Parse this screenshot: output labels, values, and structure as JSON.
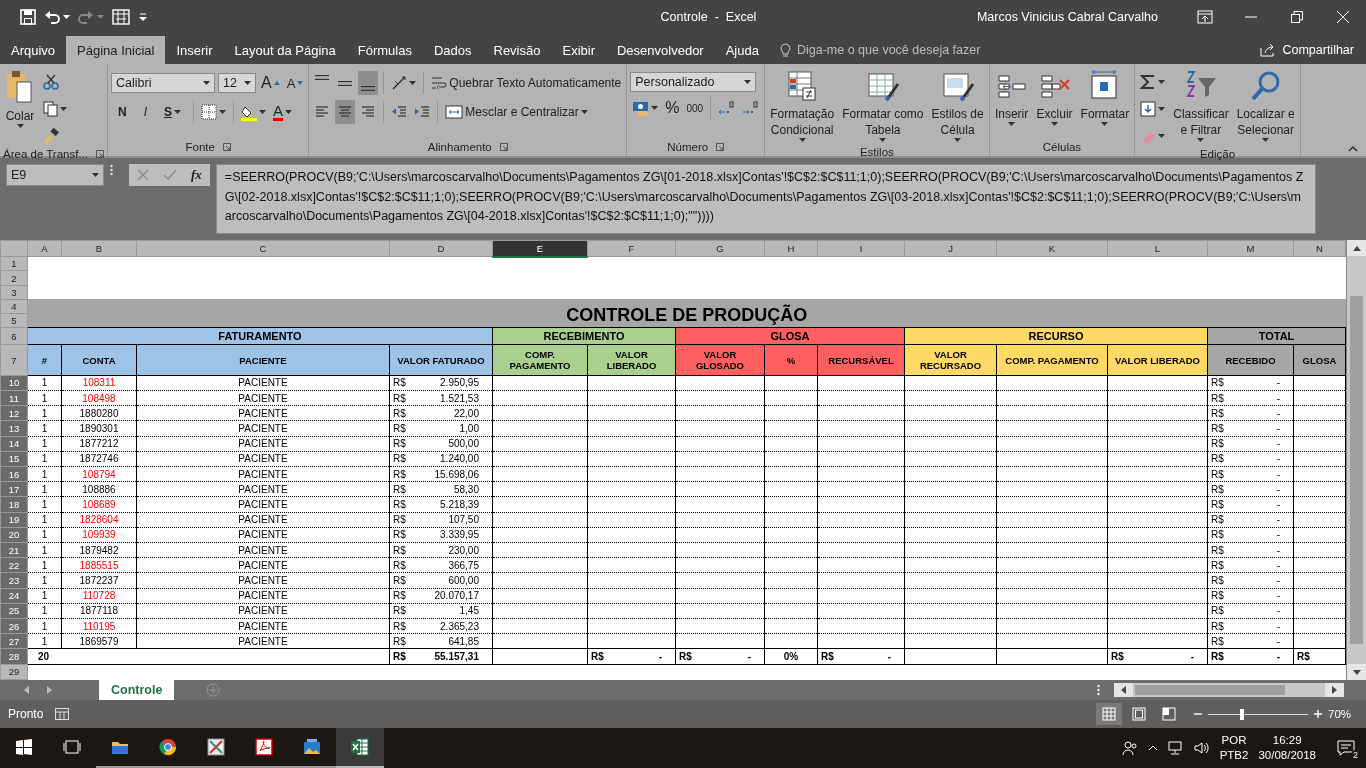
{
  "window": {
    "title": "Controle  -  Excel",
    "user": "Marcos Vinicius Cabral Carvalho"
  },
  "tabs": [
    {
      "label": "Arquivo",
      "selected": false
    },
    {
      "label": "Página Inicial",
      "selected": true
    },
    {
      "label": "Inserir",
      "selected": false
    },
    {
      "label": "Layout da Página",
      "selected": false
    },
    {
      "label": "Fórmulas",
      "selected": false
    },
    {
      "label": "Dados",
      "selected": false
    },
    {
      "label": "Revisão",
      "selected": false
    },
    {
      "label": "Exibir",
      "selected": false
    },
    {
      "label": "Desenvolvedor",
      "selected": false
    },
    {
      "label": "Ajuda",
      "selected": false
    }
  ],
  "tell_me": {
    "placeholder": "Diga-me o que você deseja fazer"
  },
  "share": "Compartilhar",
  "ribbon": [
    {
      "kind": "clipboard",
      "label": "Área de Transf...",
      "paste": "Colar"
    },
    {
      "kind": "font",
      "label": "Fonte",
      "font": "Calibri",
      "size": "12",
      "grow": "A",
      "shrink": "A",
      "bold": "N",
      "italic": "I",
      "underline": "S",
      "font_color": "A"
    },
    {
      "kind": "alignment",
      "label": "Alinhamento",
      "wrap": "Quebrar Texto Automaticamente",
      "merge": "Mesclar e Centralizar",
      "vertical": [
        {
          "selected": false
        },
        {
          "selected": false
        },
        {
          "selected": true
        }
      ],
      "horizontal": [
        {
          "selected": false
        },
        {
          "selected": true
        },
        {
          "selected": false
        }
      ]
    },
    {
      "kind": "number",
      "label": "Número",
      "format": "Personalizado",
      "percent": "%",
      "thousands": "000"
    },
    {
      "kind": "styles",
      "label": "Estilos",
      "buttons": [
        {
          "lines": [
            "Formatação",
            "Condicional"
          ]
        },
        {
          "lines": [
            "Formatar como",
            "Tabela"
          ]
        },
        {
          "lines": [
            "Estilos de",
            "Célula"
          ]
        }
      ]
    },
    {
      "kind": "cells",
      "label": "Células",
      "buttons": [
        "Inserir",
        "Excluir",
        "Formatar"
      ]
    },
    {
      "kind": "editing",
      "label": "Edição",
      "buttons": [
        {
          "lines": [
            "Classificar",
            "e Filtrar"
          ]
        },
        {
          "lines": [
            "Localizar e",
            "Selecionar"
          ]
        }
      ]
    }
  ],
  "formula_bar": {
    "cell": "E9",
    "fx": "fx",
    "formula": "=SEERRO(PROCV(B9;'C:\\Users\\marcoscarvalho\\Documents\\Pagamentos ZG\\[01-2018.xlsx]Contas'!$C$2:$C$11;1;0);SEERRO(PROCV(B9;'C:\\Users\\marcoscarvalho\\Documents\\Pagamentos ZG\\[02-2018.xlsx]Contas'!$C$2:$C$11;1;0);SEERRO(PROCV(B9;'C:\\Users\\marcoscarvalho\\Documents\\Pagamentos ZG\\[03-2018.xlsx]Contas'!$C$2:$C$11;1;0);SEERRO(PROCV(B9;'C:\\Users\\marcoscarvalho\\Documents\\Pagamentos ZG\\[04-2018.xlsx]Contas'!$C$2:$C$11;1;0);\"\"))))"
  },
  "sheet": {
    "columns": [
      {
        "label": "A",
        "selected": false
      },
      {
        "label": "B",
        "selected": false
      },
      {
        "label": "C",
        "selected": false
      },
      {
        "label": "D",
        "selected": false
      },
      {
        "label": "E",
        "selected": true
      },
      {
        "label": "F",
        "selected": false
      },
      {
        "label": "G",
        "selected": false
      },
      {
        "label": "H",
        "selected": false
      },
      {
        "label": "I",
        "selected": false
      },
      {
        "label": "J",
        "selected": false
      },
      {
        "label": "K",
        "selected": false
      },
      {
        "label": "L",
        "selected": false
      },
      {
        "label": "M",
        "selected": false
      },
      {
        "label": "N",
        "selected": false
      }
    ],
    "blank_rows": [
      {
        "row": "1",
        "highlighted": false
      },
      {
        "row": "2",
        "highlighted": false
      },
      {
        "row": "3",
        "highlighted": false
      }
    ],
    "title": {
      "text": "CONTROLE DE PRODUÇÃO",
      "rows": [
        {
          "row": "4",
          "highlighted": false
        },
        {
          "row": "5",
          "highlighted": false
        }
      ]
    },
    "group_row": {
      "row": "6",
      "highlighted": false,
      "groups": [
        {
          "label": "FATURAMENTO",
          "color": "#9dc3e6",
          "columns": [
            "#",
            "CONTA",
            "PACIENTE",
            "VALOR FATURADO"
          ]
        },
        {
          "label": "RECEBIMENTO",
          "color": "#a9d08e",
          "columns": [
            "COMP. PAGAMENTO",
            "VALOR LIBERADO"
          ]
        },
        {
          "label": "GLOSA",
          "color": "#ff5f5f",
          "columns": [
            "VALOR GLOSADO",
            "%",
            "RECURSÁVEL"
          ]
        },
        {
          "label": "RECURSO",
          "color": "#ffd966",
          "columns": [
            "VALOR RECURSADO",
            "COMP. PAGAMENTO",
            "VALOR LIBERADO"
          ]
        },
        {
          "label": "TOTAL",
          "color": "#a6a6a6",
          "columns": [
            "RECEBIDO",
            "GLOSA"
          ]
        }
      ]
    },
    "header_row": {
      "row": "7",
      "highlighted": false
    },
    "rows": [
      {
        "row": "10",
        "highlighted": true,
        "count": "1",
        "account": "108311",
        "flagged": true,
        "patient": "PACIENTE",
        "billed": {
          "currency": "R$",
          "value": "2.950,95"
        },
        "received": {
          "currency": "R$",
          "value": "-"
        }
      },
      {
        "row": "11",
        "highlighted": true,
        "count": "1",
        "account": "108498",
        "flagged": true,
        "patient": "PACIENTE",
        "billed": {
          "currency": "R$",
          "value": "1.521,53"
        },
        "received": {
          "currency": "R$",
          "value": "-"
        }
      },
      {
        "row": "12",
        "highlighted": true,
        "count": "1",
        "account": "1880280",
        "flagged": false,
        "patient": "PACIENTE",
        "billed": {
          "currency": "R$",
          "value": "22,00"
        },
        "received": {
          "currency": "R$",
          "value": "-"
        }
      },
      {
        "row": "13",
        "highlighted": true,
        "count": "1",
        "account": "1890301",
        "flagged": false,
        "patient": "PACIENTE",
        "billed": {
          "currency": "R$",
          "value": "1,00"
        },
        "received": {
          "currency": "R$",
          "value": "-"
        }
      },
      {
        "row": "14",
        "highlighted": true,
        "count": "1",
        "account": "1877212",
        "flagged": false,
        "patient": "PACIENTE",
        "billed": {
          "currency": "R$",
          "value": "500,00"
        },
        "received": {
          "currency": "R$",
          "value": "-"
        }
      },
      {
        "row": "15",
        "highlighted": true,
        "count": "1",
        "account": "1872746",
        "flagged": false,
        "patient": "PACIENTE",
        "billed": {
          "currency": "R$",
          "value": "1.240,00"
        },
        "received": {
          "currency": "R$",
          "value": "-"
        }
      },
      {
        "row": "16",
        "highlighted": true,
        "count": "1",
        "account": "108794",
        "flagged": true,
        "patient": "PACIENTE",
        "billed": {
          "currency": "R$",
          "value": "15.698,06"
        },
        "received": {
          "currency": "R$",
          "value": "-"
        }
      },
      {
        "row": "17",
        "highlighted": true,
        "count": "1",
        "account": "108886",
        "flagged": false,
        "patient": "PACIENTE",
        "billed": {
          "currency": "R$",
          "value": "58,30"
        },
        "received": {
          "currency": "R$",
          "value": "-"
        }
      },
      {
        "row": "18",
        "highlighted": true,
        "count": "1",
        "account": "108689",
        "flagged": true,
        "patient": "PACIENTE",
        "billed": {
          "currency": "R$",
          "value": "5.218,39"
        },
        "received": {
          "currency": "R$",
          "value": "-"
        }
      },
      {
        "row": "19",
        "highlighted": true,
        "count": "1",
        "account": "1828604",
        "flagged": true,
        "patient": "PACIENTE",
        "billed": {
          "currency": "R$",
          "value": "107,50"
        },
        "received": {
          "currency": "R$",
          "value": "-"
        }
      },
      {
        "row": "20",
        "highlighted": true,
        "count": "1",
        "account": "109939",
        "flagged": true,
        "patient": "PACIENTE",
        "billed": {
          "currency": "R$",
          "value": "3.339,95"
        },
        "received": {
          "currency": "R$",
          "value": "-"
        }
      },
      {
        "row": "21",
        "highlighted": true,
        "count": "1",
        "account": "1879482",
        "flagged": false,
        "patient": "PACIENTE",
        "billed": {
          "currency": "R$",
          "value": "230,00"
        },
        "received": {
          "currency": "R$",
          "value": "-"
        }
      },
      {
        "row": "22",
        "highlighted": true,
        "count": "1",
        "account": "1885515",
        "flagged": true,
        "patient": "PACIENTE",
        "billed": {
          "currency": "R$",
          "value": "366,75"
        },
        "received": {
          "currency": "R$",
          "value": "-"
        }
      },
      {
        "row": "23",
        "highlighted": true,
        "count": "1",
        "account": "1872237",
        "flagged": false,
        "patient": "PACIENTE",
        "billed": {
          "currency": "R$",
          "value": "600,00"
        },
        "received": {
          "currency": "R$",
          "value": "-"
        }
      },
      {
        "row": "24",
        "highlighted": true,
        "count": "1",
        "account": "110728",
        "flagged": true,
        "patient": "PACIENTE",
        "billed": {
          "currency": "R$",
          "value": "20.070,17"
        },
        "received": {
          "currency": "R$",
          "value": "-"
        }
      },
      {
        "row": "25",
        "highlighted": true,
        "count": "1",
        "account": "1877118",
        "flagged": false,
        "patient": "PACIENTE",
        "billed": {
          "currency": "R$",
          "value": "1,45"
        },
        "received": {
          "currency": "R$",
          "value": "-"
        }
      },
      {
        "row": "26",
        "highlighted": true,
        "count": "1",
        "account": "110195",
        "flagged": true,
        "patient": "PACIENTE",
        "billed": {
          "currency": "R$",
          "value": "2.365,23"
        },
        "received": {
          "currency": "R$",
          "value": "-"
        }
      },
      {
        "row": "27",
        "highlighted": true,
        "count": "1",
        "account": "1869579",
        "flagged": false,
        "patient": "PACIENTE",
        "billed": {
          "currency": "R$",
          "value": "641,85"
        },
        "received": {
          "currency": "R$",
          "value": "-"
        }
      }
    ],
    "total_row": {
      "row": "28",
      "highlighted": true,
      "cells": [
        {
          "value": "20"
        },
        null,
        null,
        {
          "currency": "R$",
          "value": "55.157,31"
        },
        null,
        {
          "currency": "R$",
          "value": "-"
        },
        {
          "currency": "R$",
          "value": "-"
        },
        {
          "value": "0%"
        },
        {
          "currency": "R$",
          "value": "-"
        },
        null,
        null,
        {
          "currency": "R$",
          "value": "-"
        },
        {
          "currency": "R$",
          "value": "-"
        },
        {
          "currency": "R$"
        }
      ]
    },
    "end_rows": [
      {
        "row": "29",
        "highlighted": false
      }
    ]
  },
  "sheet_tabs": [
    {
      "label": "Controle",
      "selected": true
    }
  ],
  "status_bar": {
    "text": "Pronto",
    "views": [
      {
        "selected": true
      },
      {
        "selected": false
      },
      {
        "selected": false
      }
    ],
    "zoom": {
      "level": 0.34
    },
    "zoom_text": "70%"
  },
  "taskbar": {
    "apps": [
      {
        "kind": "folder",
        "active": false
      },
      {
        "kind": "browser",
        "active": false
      },
      {
        "kind": "tool",
        "active": false
      },
      {
        "kind": "pdf",
        "active": false
      },
      {
        "kind": "photos",
        "active": false
      },
      {
        "kind": "spreadsheet",
        "active": true
      }
    ],
    "language": "POR",
    "layout": "PTB2",
    "time": "16:29",
    "date": "30/08/2018",
    "notifications": "2"
  }
}
